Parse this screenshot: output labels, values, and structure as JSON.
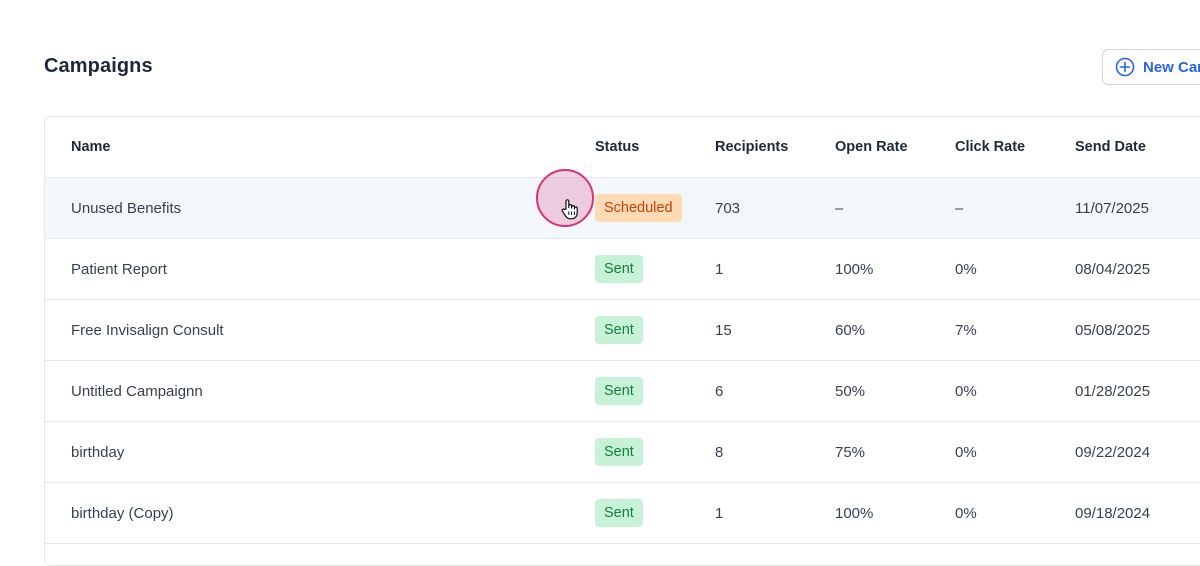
{
  "page": {
    "title": "Campaigns",
    "new_button_label": "New Campaign"
  },
  "table": {
    "columns": [
      "Name",
      "Status",
      "Recipients",
      "Open Rate",
      "Click Rate",
      "Send Date"
    ],
    "rows": [
      {
        "name": "Unused Benefits",
        "status": "Scheduled",
        "recipients": "703",
        "open_rate": "–",
        "click_rate": "–",
        "send_date": "11/07/2025"
      },
      {
        "name": "Patient Report",
        "status": "Sent",
        "recipients": "1",
        "open_rate": "100%",
        "click_rate": "0%",
        "send_date": "08/04/2025"
      },
      {
        "name": "Free Invisalign Consult",
        "status": "Sent",
        "recipients": "15",
        "open_rate": "60%",
        "click_rate": "7%",
        "send_date": "05/08/2025"
      },
      {
        "name": "Untitled Campaignn",
        "status": "Sent",
        "recipients": "6",
        "open_rate": "50%",
        "click_rate": "0%",
        "send_date": "01/28/2025"
      },
      {
        "name": "birthday",
        "status": "Sent",
        "recipients": "8",
        "open_rate": "75%",
        "click_rate": "0%",
        "send_date": "09/22/2024"
      },
      {
        "name": "birthday (Copy)",
        "status": "Sent",
        "recipients": "1",
        "open_rate": "100%",
        "click_rate": "0%",
        "send_date": "09/18/2024"
      }
    ]
  },
  "colors": {
    "accent": "#2563eb",
    "sent_bg": "#c8f2d7",
    "sent_text": "#15803d",
    "scheduled_bg": "#fdd9b4",
    "scheduled_text": "#c2410c",
    "cursor_highlight": "#d6337a"
  },
  "icons": {
    "new_button": "plus-circle-icon",
    "cursor": "hand-pointer-icon"
  }
}
